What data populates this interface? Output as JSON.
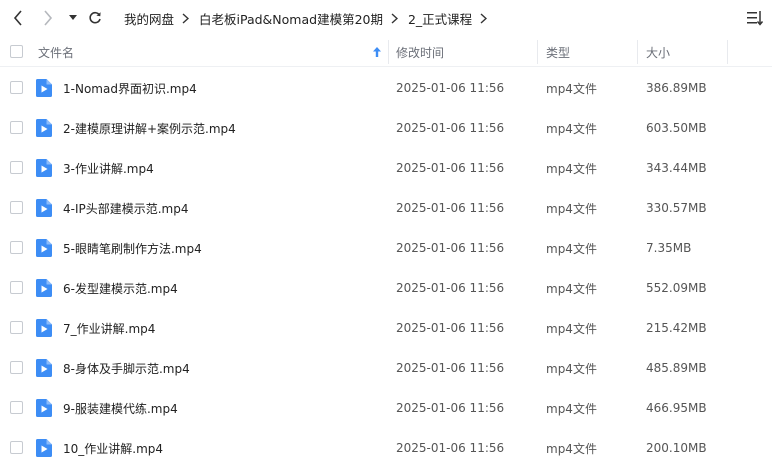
{
  "breadcrumb": [
    {
      "label": "我的网盘"
    },
    {
      "label": "白老板iPad&Nomad建模第20期"
    },
    {
      "label": "2_正式课程"
    }
  ],
  "columns": {
    "select_all": "",
    "name": "文件名",
    "modified": "修改时间",
    "type": "类型",
    "size": "大小"
  },
  "files": [
    {
      "name": "1-Nomad界面初识.mp4",
      "modified": "2025-01-06 11:56",
      "type": "mp4文件",
      "size": "386.89MB"
    },
    {
      "name": "2-建模原理讲解+案例示范.mp4",
      "modified": "2025-01-06 11:56",
      "type": "mp4文件",
      "size": "603.50MB"
    },
    {
      "name": "3-作业讲解.mp4",
      "modified": "2025-01-06 11:56",
      "type": "mp4文件",
      "size": "343.44MB"
    },
    {
      "name": "4-IP头部建模示范.mp4",
      "modified": "2025-01-06 11:56",
      "type": "mp4文件",
      "size": "330.57MB"
    },
    {
      "name": "5-眼睛笔刷制作方法.mp4",
      "modified": "2025-01-06 11:56",
      "type": "mp4文件",
      "size": "7.35MB"
    },
    {
      "name": "6-发型建模示范.mp4",
      "modified": "2025-01-06 11:56",
      "type": "mp4文件",
      "size": "552.09MB"
    },
    {
      "name": "7_作业讲解.mp4",
      "modified": "2025-01-06 11:56",
      "type": "mp4文件",
      "size": "215.42MB"
    },
    {
      "name": "8-身体及手脚示范.mp4",
      "modified": "2025-01-06 11:56",
      "type": "mp4文件",
      "size": "485.89MB"
    },
    {
      "name": "9-服装建模代练.mp4",
      "modified": "2025-01-06 11:56",
      "type": "mp4文件",
      "size": "466.95MB"
    },
    {
      "name": "10_作业讲解.mp4",
      "modified": "2025-01-06 11:56",
      "type": "mp4文件",
      "size": "200.10MB"
    }
  ],
  "icons": {
    "back": "chevron-left-icon",
    "forward": "chevron-right-icon",
    "history": "caret-down-icon",
    "refresh": "refresh-icon",
    "sort": "sort-arrow-up-icon",
    "view": "list-view-icon",
    "file": "video-file-icon"
  },
  "colors": {
    "file_icon": "#3d8df5",
    "sort_arrow": "#3d8df5",
    "header_text": "#6b6f78"
  }
}
